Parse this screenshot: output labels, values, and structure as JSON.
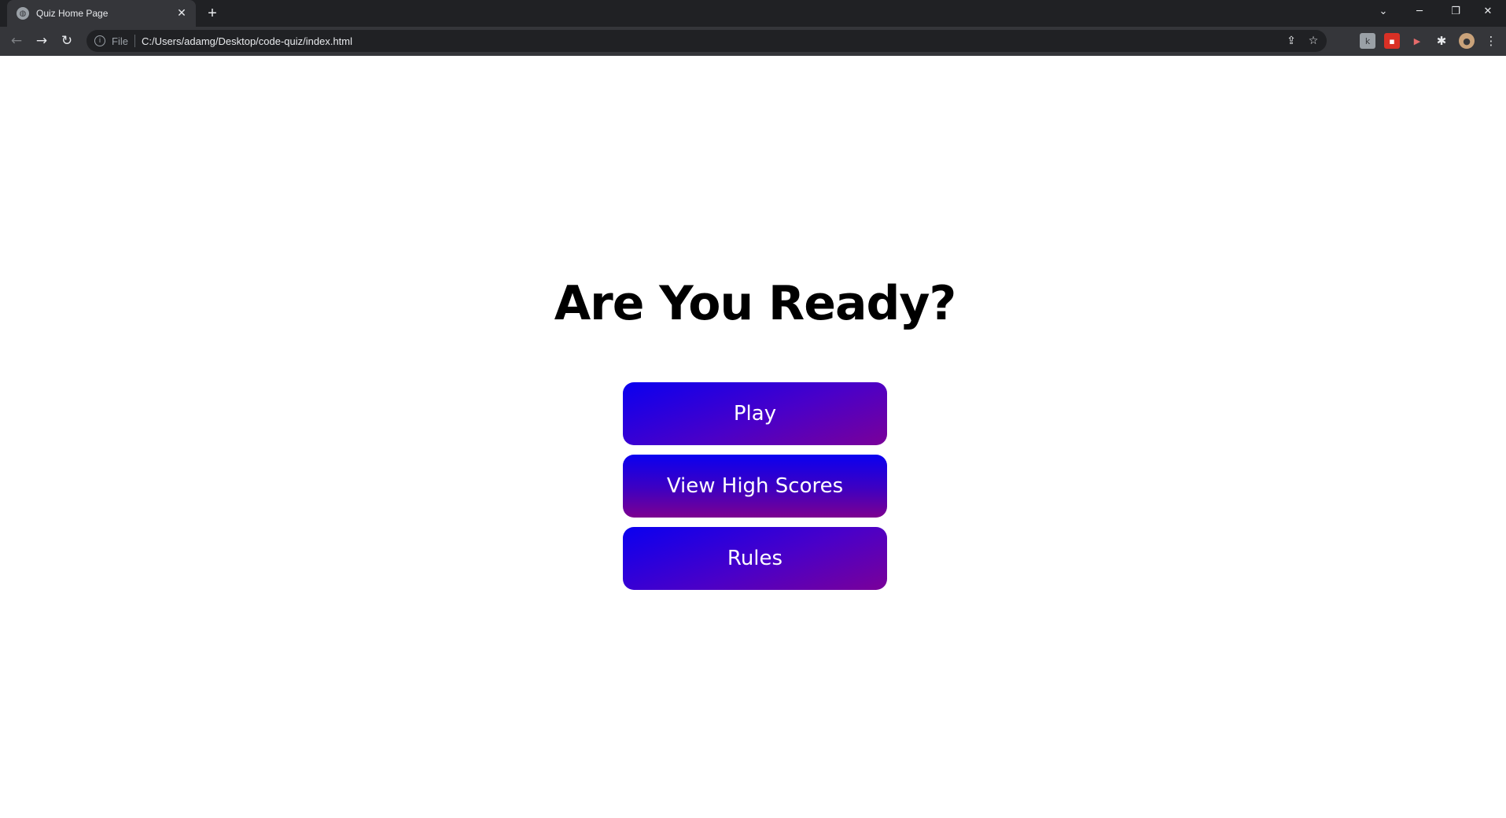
{
  "browser": {
    "tab_title": "Quiz Home Page",
    "new_tab_label": "+",
    "scheme_label": "File",
    "url": "C:/Users/adamg/Desktop/code-quiz/index.html"
  },
  "page": {
    "heading": "Are You Ready?",
    "buttons": {
      "play": "Play",
      "high_scores": "View High Scores",
      "rules": "Rules"
    }
  },
  "colors": {
    "button_gradient_start": "#0a00f0",
    "button_gradient_end": "#7d0090",
    "chrome_dark": "#202124",
    "chrome_toolbar": "#35363a"
  }
}
